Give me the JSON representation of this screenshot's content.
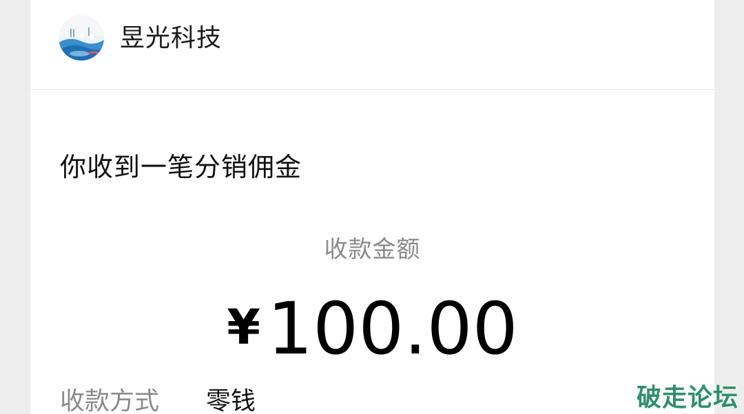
{
  "merchant": {
    "name": "昱光科技",
    "avatar_icon": "merchant-logo-icon"
  },
  "notice": {
    "title": "你收到一笔分销佣金"
  },
  "payment": {
    "amount_label": "收款金额",
    "currency_symbol": "¥",
    "amount": "100.00",
    "method_label": "收款方式",
    "method_value": "零钱"
  },
  "watermark": {
    "text": "破走论坛",
    "color": "#2f8f6a"
  }
}
